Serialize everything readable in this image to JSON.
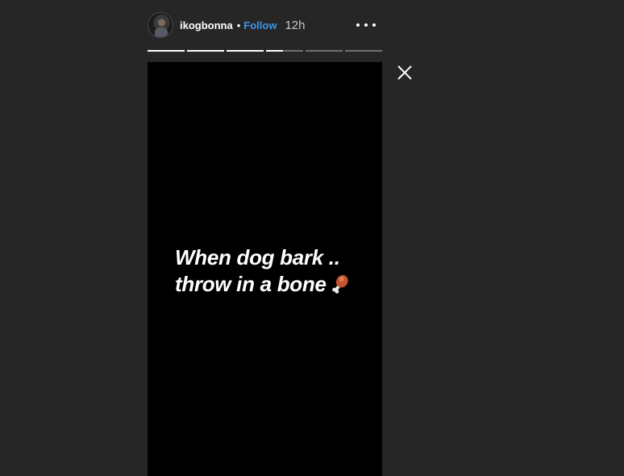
{
  "header": {
    "username": "ikogbonna",
    "separator": "•",
    "follow_label": "Follow",
    "time_ago": "12h"
  },
  "progress": {
    "segments": [
      1,
      1,
      1,
      0.45,
      0,
      0
    ]
  },
  "story": {
    "caption_line1": "When dog bark ..",
    "caption_line2": "throw in a bone",
    "emoji_icon": "meat-on-bone-icon"
  },
  "colors": {
    "background": "#262626",
    "story_bg": "#000000",
    "follow": "#3897f0",
    "text": "#ffffff"
  }
}
